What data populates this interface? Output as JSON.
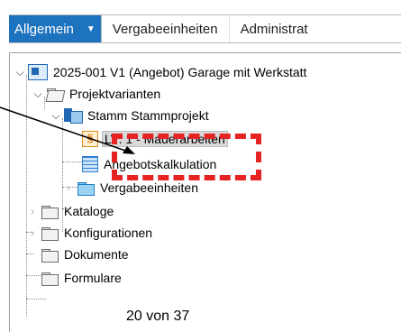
{
  "tabs": {
    "active": "Allgemein",
    "items": [
      "Vergabeeinheiten",
      "Administrat"
    ]
  },
  "tree": {
    "root": "2025-001 V1 (Angebot) Garage mit Werkstatt",
    "projektvarianten": "Projektvarianten",
    "stamm": "Stamm Stammprojekt",
    "lv": "LV: 1 - Mauerarbeiten",
    "kalkulation": "Angebotskalkulation",
    "vergabeeinheiten": "Vergabeeinheiten",
    "kataloge": "Kataloge",
    "konfigurationen": "Konfigurationen",
    "dokumente": "Dokumente",
    "formulare": "Formulare"
  },
  "lv_icon_glyph": "§",
  "page_label": "20 von 37",
  "colors": {
    "tab_active_bg": "#1e73be",
    "annotation": "#e62323",
    "selection_bg": "#d9d9d9"
  }
}
